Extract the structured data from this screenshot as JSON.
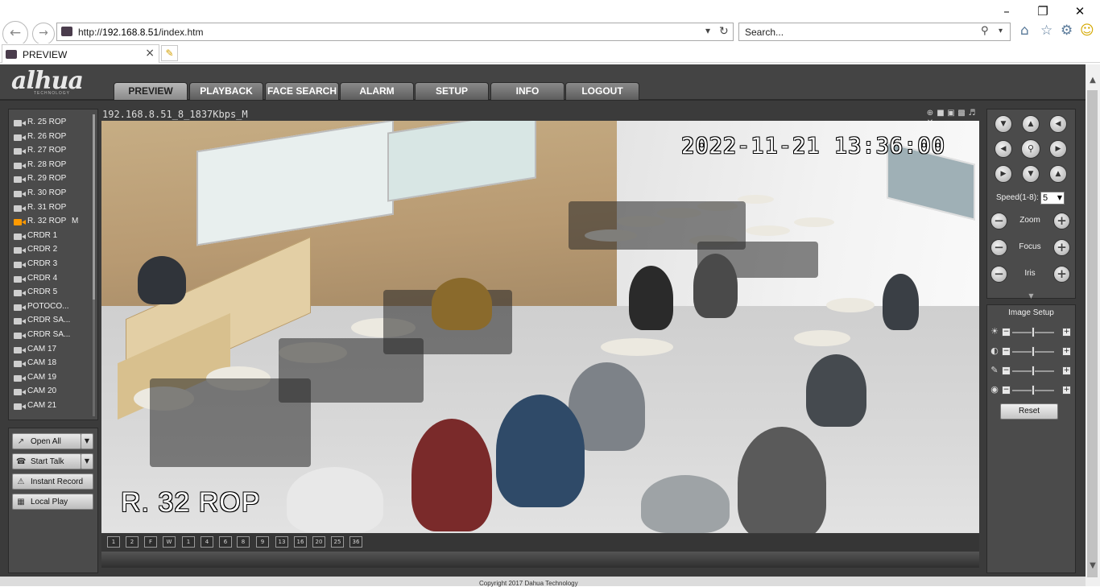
{
  "browser": {
    "url_prefix": "http://",
    "url_host": "192.168.8.51",
    "url_path": "/index.htm",
    "search_placeholder": "Search...",
    "tab_title": "PREVIEW"
  },
  "app": {
    "logo_text": "alhua",
    "logo_sub": "TECHNOLOGY",
    "menu": [
      "PREVIEW",
      "PLAYBACK",
      "FACE SEARCH",
      "ALARM",
      "SETUP",
      "INFO",
      "LOGOUT"
    ],
    "active_menu": "PREVIEW"
  },
  "channels": [
    {
      "label": "R. 25 ROP",
      "active": false,
      "flag": ""
    },
    {
      "label": "R. 26 ROP",
      "active": false,
      "flag": ""
    },
    {
      "label": "R. 27 ROP",
      "active": false,
      "flag": ""
    },
    {
      "label": "R. 28 ROP",
      "active": false,
      "flag": ""
    },
    {
      "label": "R. 29 ROP",
      "active": false,
      "flag": ""
    },
    {
      "label": "R. 30 ROP",
      "active": false,
      "flag": ""
    },
    {
      "label": "R. 31 ROP",
      "active": false,
      "flag": ""
    },
    {
      "label": "R. 32 ROP",
      "active": true,
      "flag": "M"
    },
    {
      "label": "CRDR 1",
      "active": false,
      "flag": ""
    },
    {
      "label": "CRDR 2",
      "active": false,
      "flag": ""
    },
    {
      "label": "CRDR 3",
      "active": false,
      "flag": ""
    },
    {
      "label": "CRDR 4",
      "active": false,
      "flag": ""
    },
    {
      "label": "CRDR 5",
      "active": false,
      "flag": ""
    },
    {
      "label": "POTOCO...",
      "active": false,
      "flag": ""
    },
    {
      "label": "CRDR SA...",
      "active": false,
      "flag": ""
    },
    {
      "label": "CRDR SA...",
      "active": false,
      "flag": ""
    },
    {
      "label": "CAM 17",
      "active": false,
      "flag": ""
    },
    {
      "label": "CAM 18",
      "active": false,
      "flag": ""
    },
    {
      "label": "CAM 19",
      "active": false,
      "flag": ""
    },
    {
      "label": "CAM 20",
      "active": false,
      "flag": ""
    },
    {
      "label": "CAM 21",
      "active": false,
      "flag": ""
    }
  ],
  "actions": {
    "open_all": "Open All",
    "start_talk": "Start Talk",
    "instant_record": "Instant Record",
    "local_play": "Local Play"
  },
  "video": {
    "stream_info": "192.168.8.51_8_1837Kbps_M",
    "timestamp": "2022-11-21  13:36:00",
    "channel_overlay": "R. 32 ROP"
  },
  "layout_options": [
    "1",
    "2",
    "F",
    "W",
    "1",
    "4",
    "6",
    "8",
    "9",
    "13",
    "16",
    "20",
    "25",
    "36"
  ],
  "ptz": {
    "speed_label": "Speed(1-8):",
    "speed_value": "5",
    "zoom_label": "Zoom",
    "focus_label": "Focus",
    "iris_label": "Iris"
  },
  "image_setup": {
    "title": "Image Setup",
    "reset_label": "Reset",
    "brightness": 0.5,
    "contrast": 0.5,
    "saturation": 0.5,
    "hue": 0.5
  },
  "footer": {
    "text": "Copyright 2017 Dahua Technology"
  }
}
